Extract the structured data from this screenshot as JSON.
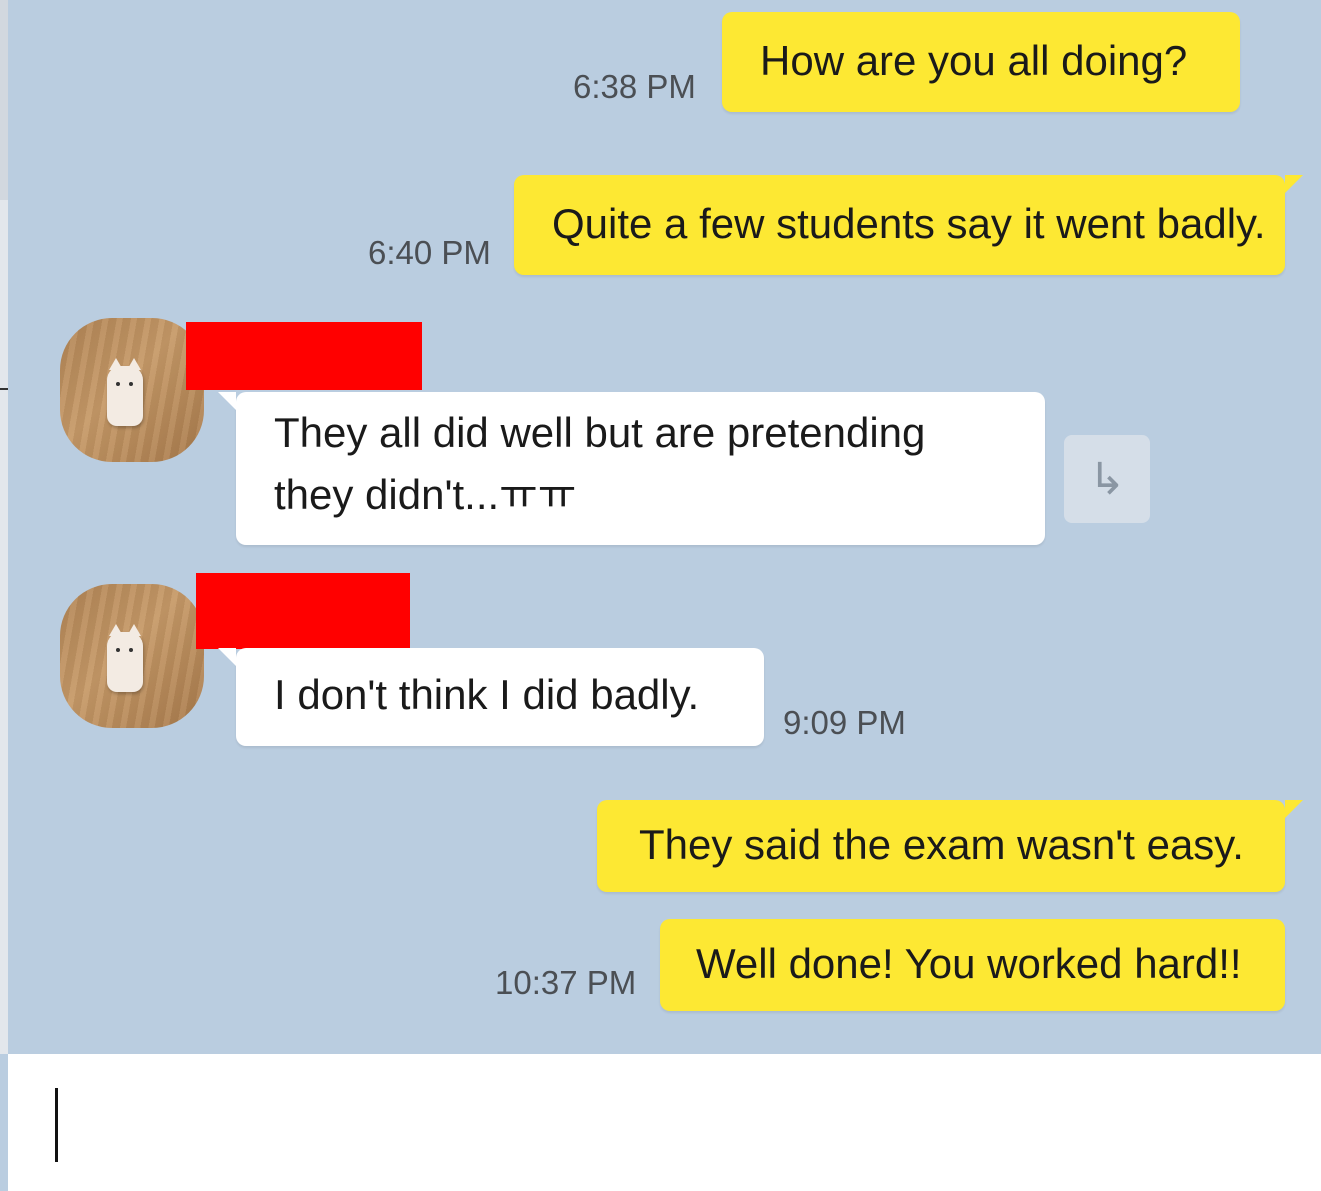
{
  "messages": [
    {
      "id": "m1",
      "sender": "me",
      "text": "How are you all doing?",
      "time": "6:38 PM"
    },
    {
      "id": "m2",
      "sender": "me",
      "text": "Quite a few students say it went badly.",
      "time": "6:40 PM"
    },
    {
      "id": "m3",
      "sender": "other",
      "text": "They all did well but are pretending they didn't...ㅠㅠ",
      "time": ""
    },
    {
      "id": "m4",
      "sender": "other",
      "text": "I don't think I did badly.",
      "time": "9:09 PM"
    },
    {
      "id": "m5",
      "sender": "me",
      "text": "They said the exam wasn't easy.",
      "time": ""
    },
    {
      "id": "m6",
      "sender": "me",
      "text": "Well done! You worked hard!!",
      "time": "10:37 PM"
    }
  ],
  "share_icon": "share-arrow-icon",
  "colors": {
    "background": "#bacde0",
    "my_bubble": "#fde833",
    "their_bubble": "#ffffff",
    "redaction": "#ff0000"
  }
}
